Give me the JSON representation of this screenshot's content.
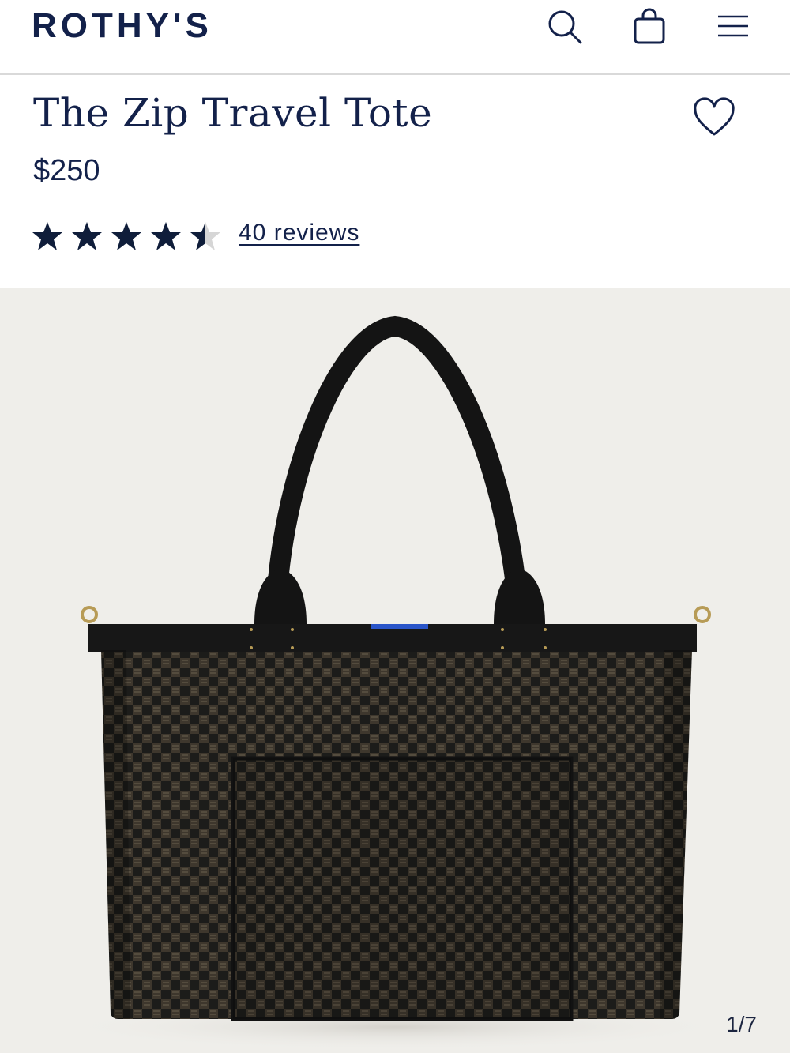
{
  "header": {
    "logo": "ROTHY'S",
    "icons": [
      "search-icon",
      "shopping-bag-icon",
      "hamburger-menu-icon"
    ]
  },
  "product": {
    "title": "The Zip Travel Tote",
    "price": "$250",
    "rating": 4.5,
    "rating_max": 5,
    "reviews_label": "40 reviews",
    "favorite_icon": "heart-icon"
  },
  "gallery": {
    "counter": "1/7",
    "current_index": 1,
    "total": 7
  },
  "colors": {
    "brand_navy": "#13214a",
    "gallery_bg": "#efeeea",
    "bag_black": "#1b1b1a",
    "accent_blue": "#2a55c9"
  }
}
